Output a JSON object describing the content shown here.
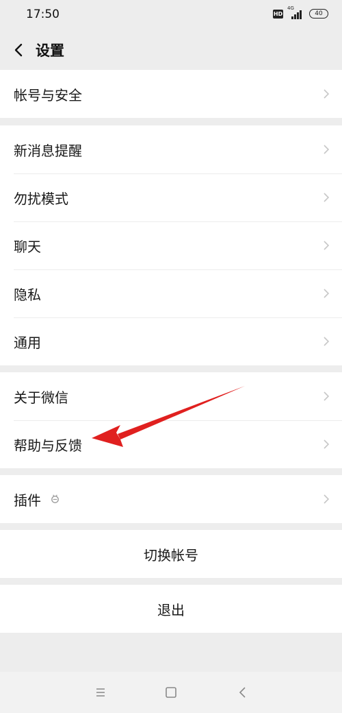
{
  "status_bar": {
    "time": "17:50",
    "hd_label": "HD",
    "network_label": "4G",
    "battery_level": "40"
  },
  "nav": {
    "title": "设置",
    "back_icon": "chevron-left-icon"
  },
  "settings": {
    "account": {
      "label": "帐号与安全"
    },
    "notifications": {
      "label": "新消息提醒"
    },
    "do_not_disturb": {
      "label": "勿扰模式"
    },
    "chat": {
      "label": "聊天"
    },
    "privacy": {
      "label": "隐私"
    },
    "general": {
      "label": "通用"
    },
    "about": {
      "label": "关于微信"
    },
    "help": {
      "label": "帮助与反馈"
    },
    "plugins": {
      "label": "插件",
      "badge_icon": "plugin-bug-icon"
    }
  },
  "actions": {
    "switch_account": "切换帐号",
    "logout": "退出"
  },
  "system_nav": {
    "menu_icon": "menu-icon",
    "home_icon": "home-square-icon",
    "back_icon": "back-triangle-icon"
  },
  "annotation": {
    "arrow_color": "#e0201f",
    "points_to": "帮助与反馈"
  },
  "colors": {
    "background": "#ededed",
    "row_background": "#ffffff",
    "text": "#191919"
  }
}
